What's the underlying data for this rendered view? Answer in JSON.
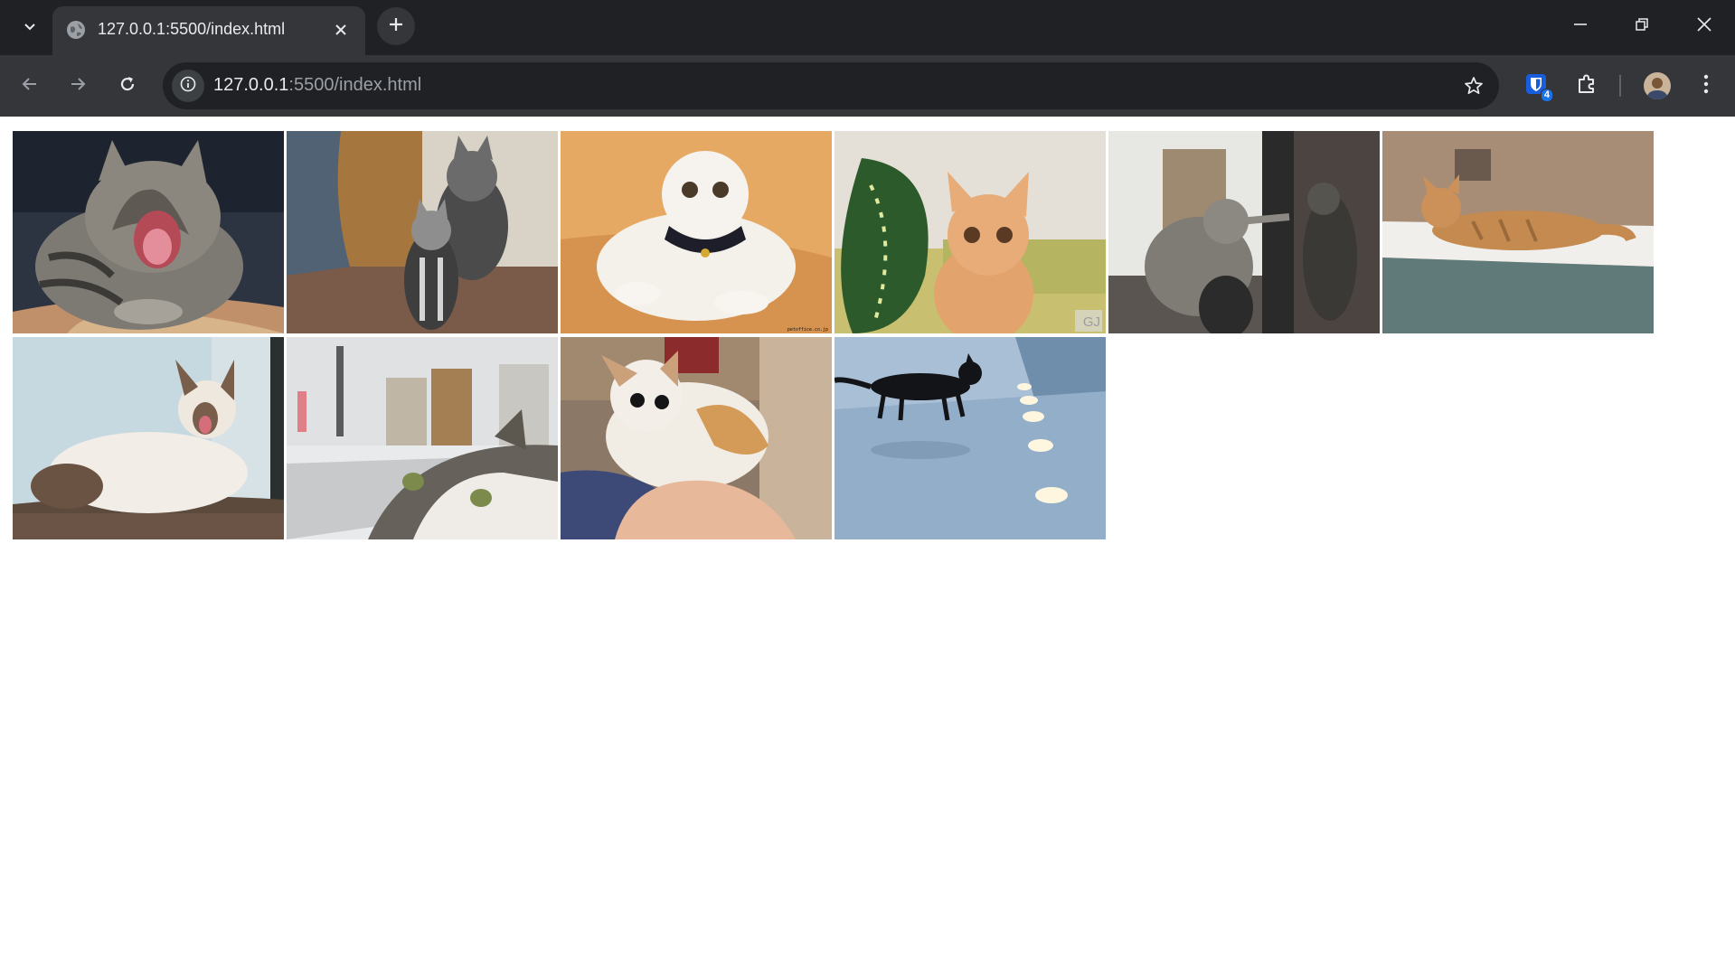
{
  "browser": {
    "tab": {
      "title": "127.0.0.1:5500/index.html"
    },
    "omnibox": {
      "host": "127.0.0.1",
      "rest": ":5500/index.html"
    },
    "extension_badge": "4"
  },
  "gallery": {
    "images": [
      {
        "subject": "tabby cat yawning on cushion"
      },
      {
        "subject": "two tabby cats standing near door"
      },
      {
        "subject": "white scottish fold kitten in sailor collar",
        "watermark": "petoffice.co.jp"
      },
      {
        "subject": "orange kitten beside green leaf",
        "watermark": "GJ"
      },
      {
        "subject": "grey cats at glass door"
      },
      {
        "subject": "orange cat sleeping on ledge"
      },
      {
        "subject": "siamese cat yawning"
      },
      {
        "subject": "tabby cat peeking over sink"
      },
      {
        "subject": "calico kitten held in hand"
      },
      {
        "subject": "black cat on blue floor with lights"
      }
    ]
  }
}
